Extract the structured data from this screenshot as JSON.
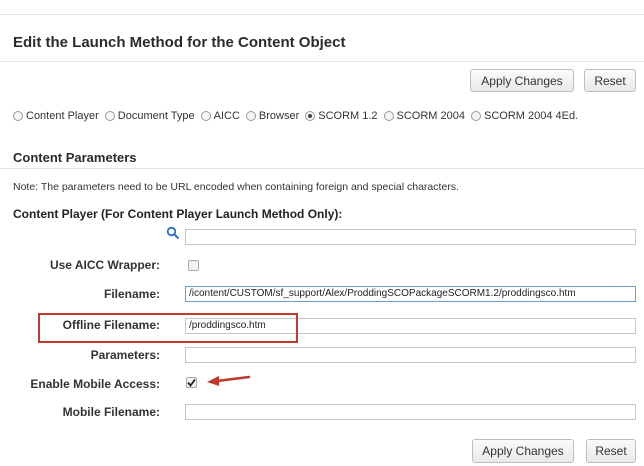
{
  "header": {
    "title": "Edit the Launch Method for the Content Object"
  },
  "toolbar": {
    "apply_label": "Apply Changes",
    "reset_label": "Reset"
  },
  "launch_methods": [
    {
      "label": "Content Player",
      "selected": false
    },
    {
      "label": "Document Type",
      "selected": false
    },
    {
      "label": "AICC",
      "selected": false
    },
    {
      "label": "Browser",
      "selected": false
    },
    {
      "label": "SCORM 1.2",
      "selected": true
    },
    {
      "label": "SCORM 2004",
      "selected": false
    },
    {
      "label": "SCORM 2004 4Ed.",
      "selected": false
    }
  ],
  "content_params": {
    "section_title": "Content Parameters",
    "note": "Note: The parameters need to be URL encoded when containing foreign and special characters.",
    "subheading": "Content Player (For Content Player Launch Method Only):",
    "search_value": "",
    "use_aicc_label": "Use AICC Wrapper:",
    "use_aicc_checked": false,
    "filename_label": "Filename:",
    "filename_value": "/icontent/CUSTOM/sf_support/Alex/ProddingSCOPackageSCORM1.2/proddingsco.htm",
    "offline_label": "Offline Filename:",
    "offline_value": "/proddingsco.htm",
    "parameters_label": "Parameters:",
    "parameters_value": "",
    "mobile_access_label": "Enable Mobile Access:",
    "mobile_access_checked": true,
    "mobile_filename_label": "Mobile Filename:",
    "mobile_filename_value": ""
  },
  "colors": {
    "highlight_box": "#c0392b",
    "arrow": "#c0392b",
    "search_icon": "#2f6fc9",
    "focus_border": "#6aa0d6"
  },
  "icons": {
    "search": "magnifier-icon",
    "checked": "checkmark-icon",
    "annotation": "red-arrow-icon"
  }
}
